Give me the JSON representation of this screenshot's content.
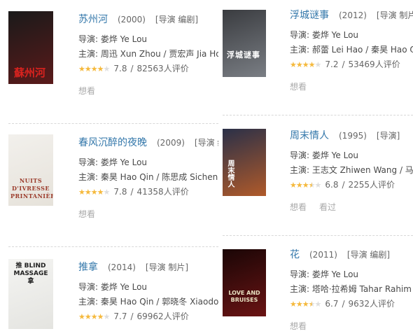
{
  "films": [
    {
      "title": "苏州河",
      "year": "(2000)",
      "tags": "[导演 编剧]",
      "director": "导演: 娄烨 Ye Lou",
      "cast": "主演: 周迅 Xun Zhou / 贾宏声 Jia Hongsheng",
      "stars": 4,
      "score": "7.8",
      "sep": "/",
      "votes": "82563人评价",
      "actions": [
        "想看"
      ],
      "poster_text": "蘇州河",
      "poster_colors": [
        "#1a1a1a",
        "#5a1a1a"
      ],
      "poster_text_color": "#d8231f"
    },
    {
      "title": "春风沉醉的夜晚",
      "year": "(2009)",
      "tags": "[导演 编剧]",
      "director": "导演: 娄烨 Ye Lou",
      "cast": "主演: 秦昊 Hao Qin / 陈思成 Sicheng Chen",
      "stars": 4,
      "score": "7.8",
      "sep": "/",
      "votes": "41358人评价",
      "actions": [
        "想看"
      ],
      "poster_text": "NUITS D'IVRESSE PRINTANIÈRE",
      "poster_colors": [
        "#f2f0ec",
        "#e6e2da"
      ],
      "poster_text_color": "#9b3a2a"
    },
    {
      "title": "推拿",
      "year": "(2014)",
      "tags": "[导演 制片]",
      "director": "导演: 娄烨 Ye Lou",
      "cast": "主演: 秦昊 Hao Qin / 郭晓冬 Xiaodong Guo",
      "stars": 4,
      "score": "7.7",
      "sep": "/",
      "votes": "69962人评价",
      "actions": [],
      "poster_text": "推 BLIND MASSAGE 拿",
      "poster_colors": [
        "#f4f4f2",
        "#e4e4e0"
      ],
      "poster_text_color": "#222222"
    },
    {
      "title": "浮城谜事",
      "year": "(2012)",
      "tags": "[导演 制片 编剧]",
      "director": "导演: 娄烨 Ye Lou",
      "cast": "主演: 郝蕾 Lei Hao / 秦昊 Hao Qin",
      "stars": 4,
      "score": "7.2",
      "sep": "/",
      "votes": "53469人评价",
      "actions": [
        "想看"
      ],
      "poster_text": "浮城谜事",
      "poster_colors": [
        "#3a3c40",
        "#7a7e84"
      ],
      "poster_text_color": "#ffffff"
    },
    {
      "title": "周末情人",
      "year": "(1995)",
      "tags": "[导演]",
      "director": "导演: 娄烨 Ye Lou",
      "cast": "主演: 王志文 Zhiwen Wang / 马晓晴 Xiaoqing Ma",
      "stars": 3.5,
      "score": "6.8",
      "sep": "/",
      "votes": "2255人评价",
      "actions": [
        "想看",
        "看过"
      ],
      "poster_text": "周末情人",
      "poster_colors": [
        "#2a3048",
        "#b05a2a"
      ],
      "poster_text_color": "#ffffff"
    },
    {
      "title": "花",
      "year": "(2011)",
      "tags": "[导演 编剧]",
      "director": "导演: 娄烨 Ye Lou",
      "cast": "主演: 塔哈·拉希姆 Tahar Rahim / 伦",
      "stars": 3.5,
      "score": "6.7",
      "sep": "/",
      "votes": "9632人评价",
      "actions": [
        "想看"
      ],
      "poster_text": "LOVE AND BRUISES",
      "poster_colors": [
        "#1a0606",
        "#6a1414"
      ],
      "poster_text_color": "#e8e0c0"
    }
  ]
}
